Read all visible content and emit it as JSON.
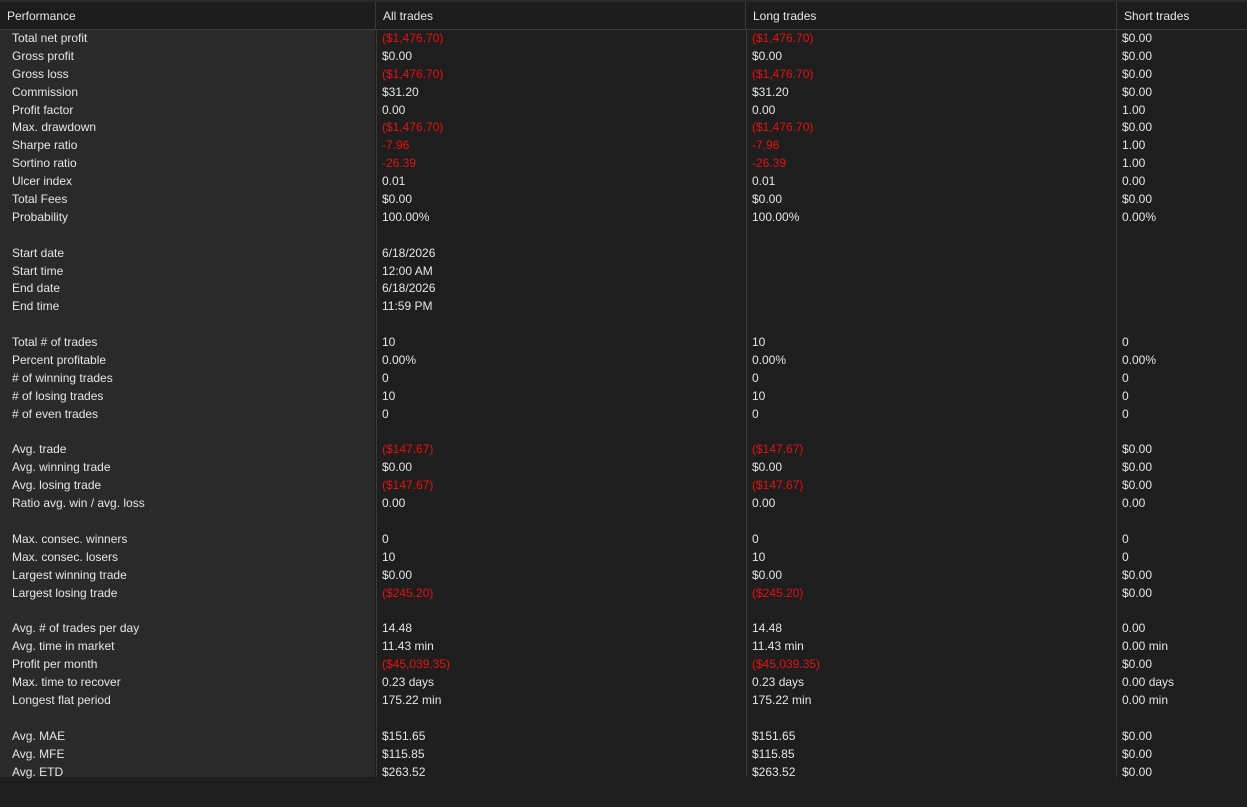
{
  "header": {
    "columns": [
      "Performance",
      "All trades",
      "Long trades",
      "Short trades"
    ]
  },
  "rows": [
    {
      "label": "Total net profit",
      "all": "($1,476.70)",
      "long": "($1,476.70)",
      "short": "$0.00"
    },
    {
      "label": "Gross profit",
      "all": "$0.00",
      "long": "$0.00",
      "short": "$0.00"
    },
    {
      "label": "Gross loss",
      "all": "($1,476.70)",
      "long": "($1,476.70)",
      "short": "$0.00"
    },
    {
      "label": "Commission",
      "all": "$31.20",
      "long": "$31.20",
      "short": "$0.00"
    },
    {
      "label": "Profit factor",
      "all": "0.00",
      "long": "0.00",
      "short": "1.00"
    },
    {
      "label": "Max. drawdown",
      "all": "($1,476.70)",
      "long": "($1,476.70)",
      "short": "$0.00"
    },
    {
      "label": "Sharpe ratio",
      "all": "-7.96",
      "long": "-7.96",
      "short": "1.00"
    },
    {
      "label": "Sortino ratio",
      "all": "-26.39",
      "long": "-26.39",
      "short": "1.00"
    },
    {
      "label": "Ulcer index",
      "all": "0.01",
      "long": "0.01",
      "short": "0.00"
    },
    {
      "label": "Total Fees",
      "all": "$0.00",
      "long": "$0.00",
      "short": "$0.00"
    },
    {
      "label": "Probability",
      "all": "100.00%",
      "long": "100.00%",
      "short": "0.00%"
    },
    {
      "label": "",
      "all": "",
      "long": "",
      "short": ""
    },
    {
      "label": "Start date",
      "all": "6/18/2026",
      "long": "",
      "short": ""
    },
    {
      "label": "Start time",
      "all": "12:00 AM",
      "long": "",
      "short": ""
    },
    {
      "label": "End date",
      "all": "6/18/2026",
      "long": "",
      "short": ""
    },
    {
      "label": "End time",
      "all": "11:59 PM",
      "long": "",
      "short": ""
    },
    {
      "label": "",
      "all": "",
      "long": "",
      "short": ""
    },
    {
      "label": "Total # of trades",
      "all": "10",
      "long": "10",
      "short": "0"
    },
    {
      "label": "Percent profitable",
      "all": "0.00%",
      "long": "0.00%",
      "short": "0.00%"
    },
    {
      "label": "# of winning trades",
      "all": "0",
      "long": "0",
      "short": "0"
    },
    {
      "label": "# of losing trades",
      "all": "10",
      "long": "10",
      "short": "0"
    },
    {
      "label": "# of even trades",
      "all": "0",
      "long": "0",
      "short": "0"
    },
    {
      "label": "",
      "all": "",
      "long": "",
      "short": ""
    },
    {
      "label": "Avg. trade",
      "all": "($147.67)",
      "long": "($147.67)",
      "short": "$0.00"
    },
    {
      "label": "Avg. winning trade",
      "all": "$0.00",
      "long": "$0.00",
      "short": "$0.00"
    },
    {
      "label": "Avg. losing trade",
      "all": "($147.67)",
      "long": "($147.67)",
      "short": "$0.00"
    },
    {
      "label": "Ratio avg. win / avg. loss",
      "all": "0.00",
      "long": "0.00",
      "short": "0.00"
    },
    {
      "label": "",
      "all": "",
      "long": "",
      "short": ""
    },
    {
      "label": "Max. consec. winners",
      "all": "0",
      "long": "0",
      "short": "0"
    },
    {
      "label": "Max. consec. losers",
      "all": "10",
      "long": "10",
      "short": "0"
    },
    {
      "label": "Largest winning trade",
      "all": "$0.00",
      "long": "$0.00",
      "short": "$0.00"
    },
    {
      "label": "Largest losing trade",
      "all": "($245.20)",
      "long": "($245.20)",
      "short": "$0.00"
    },
    {
      "label": "",
      "all": "",
      "long": "",
      "short": ""
    },
    {
      "label": "Avg. # of trades per day",
      "all": "14.48",
      "long": "14.48",
      "short": "0.00"
    },
    {
      "label": "Avg. time in market",
      "all": "11.43 min",
      "long": "11.43 min",
      "short": "0.00 min"
    },
    {
      "label": "Profit per month",
      "all": "($45,039.35)",
      "long": "($45,039.35)",
      "short": "$0.00"
    },
    {
      "label": "Max. time to recover",
      "all": "0.23 days",
      "long": "0.23 days",
      "short": "0.00 days"
    },
    {
      "label": "Longest flat period",
      "all": "175.22 min",
      "long": "175.22 min",
      "short": "0.00 min"
    },
    {
      "label": "",
      "all": "",
      "long": "",
      "short": ""
    },
    {
      "label": "Avg. MAE",
      "all": "$151.65",
      "long": "$151.65",
      "short": "$0.00"
    },
    {
      "label": "Avg. MFE",
      "all": "$115.85",
      "long": "$115.85",
      "short": "$0.00"
    },
    {
      "label": "Avg. ETD",
      "all": "$263.52",
      "long": "$263.52",
      "short": "$0.00"
    }
  ],
  "colors": {
    "negative": "#e81010",
    "text": "#e6e6e6",
    "background": "#1e1e1e",
    "label_column": "#2a2a2a"
  }
}
